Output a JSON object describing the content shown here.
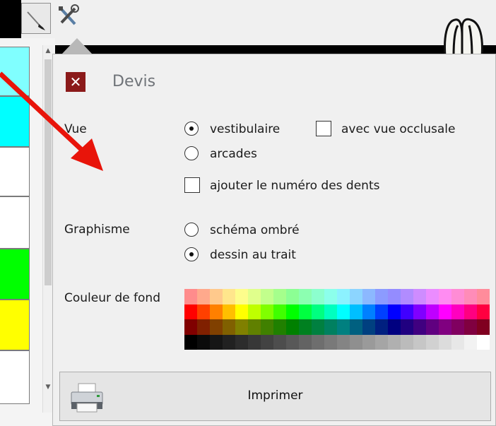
{
  "panel": {
    "title": "Devis",
    "close_glyph": "✕",
    "vue": {
      "label": "Vue",
      "options": [
        {
          "label": "vestibulaire",
          "selected": true
        },
        {
          "label": "arcades",
          "selected": false
        }
      ],
      "occlusal_checkbox": {
        "label": "avec vue occlusale",
        "checked": false
      },
      "numero_checkbox": {
        "label": "ajouter le numéro des dents",
        "checked": false
      }
    },
    "graphisme": {
      "label": "Graphisme",
      "options": [
        {
          "label": "schéma ombré",
          "selected": false
        },
        {
          "label": "dessin au trait",
          "selected": true
        }
      ]
    },
    "couleur_de_fond": {
      "label": "Couleur de fond",
      "palette_rows": [
        [
          "#ff8c8c",
          "#ffa98c",
          "#ffc98c",
          "#ffe68c",
          "#fdfd8c",
          "#e0ff8c",
          "#c2ff8c",
          "#a5ff8c",
          "#8cff94",
          "#8cffb1",
          "#8cffce",
          "#8cffeb",
          "#8cf2ff",
          "#8cd5ff",
          "#8cb8ff",
          "#8c9bff",
          "#948cff",
          "#b18cff",
          "#ce8cff",
          "#eb8cff",
          "#ff8cf2",
          "#ff8cd5",
          "#ff8cb8",
          "#ff8c9b"
        ],
        [
          "#ff0000",
          "#ff4000",
          "#ff8000",
          "#ffbf00",
          "#ffff00",
          "#bfff00",
          "#80ff00",
          "#40ff00",
          "#00ff00",
          "#00ff40",
          "#00ff80",
          "#00ffbf",
          "#00ffff",
          "#00bfff",
          "#0080ff",
          "#0040ff",
          "#0000ff",
          "#4000ff",
          "#8000ff",
          "#bf00ff",
          "#ff00ff",
          "#ff00bf",
          "#ff0080",
          "#ff0040"
        ],
        [
          "#800000",
          "#802000",
          "#804000",
          "#806000",
          "#808000",
          "#608000",
          "#408000",
          "#208000",
          "#008000",
          "#008020",
          "#008040",
          "#008060",
          "#008080",
          "#006080",
          "#004080",
          "#002080",
          "#000080",
          "#200080",
          "#400080",
          "#600080",
          "#800080",
          "#800060",
          "#800040",
          "#800020"
        ],
        [
          "#000000",
          "#0b0b0b",
          "#161616",
          "#212121",
          "#2c2c2c",
          "#373737",
          "#424242",
          "#4d4d4d",
          "#585858",
          "#636363",
          "#6e6e6e",
          "#797979",
          "#848484",
          "#8f8f8f",
          "#9a9a9a",
          "#a5a5a5",
          "#b0b0b0",
          "#bbbbbb",
          "#c6c6c6",
          "#d1d1d1",
          "#dcdcdc",
          "#e7e7e7",
          "#f2f2f2",
          "#ffffff"
        ]
      ]
    },
    "print_button": {
      "label": "Imprimer",
      "icon": "printer-icon"
    }
  },
  "toolbar": {
    "icons": [
      "brush-icon",
      "tools-icon",
      "teeth-icon"
    ]
  },
  "left_strip": {
    "cells": [
      "#80ffff",
      "#00ffff",
      "#ffffff",
      "#ffffff",
      "#00ff00",
      "#ffff00",
      "#ffffff"
    ]
  },
  "annotation": {
    "arrow_color": "#e8140a"
  }
}
